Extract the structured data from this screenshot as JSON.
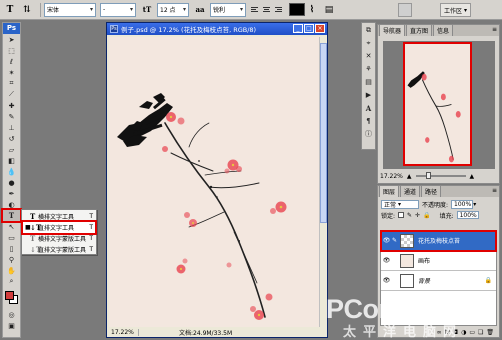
{
  "options_bar": {
    "tool_icon": "type-tool-icon",
    "orientation_icon": "text-orientation-icon",
    "font_family": "宋体",
    "font_style": "-",
    "size_icon": "font-size-icon",
    "font_size": "12 点",
    "aa_icon": "anti-alias-icon",
    "anti_alias": "锐利",
    "text_color": "#000000",
    "workspace_label": "工作区"
  },
  "toolbox": {
    "logo": "Ps",
    "foreground_color": "#d23c3c",
    "background_color": "#ffffff"
  },
  "flyout": {
    "items": [
      {
        "label": "横排文字工具",
        "shortcut": "T",
        "selected": false
      },
      {
        "label": "直排文字工具",
        "shortcut": "T",
        "selected": true
      },
      {
        "label": "横排文字蒙版工具",
        "shortcut": "T",
        "selected": false
      },
      {
        "label": "直排文字蒙版工具",
        "shortcut": "T",
        "selected": false
      }
    ]
  },
  "document": {
    "title": "例子.psd @ 17.2% (花托及梅枝点苔, RGB/8)",
    "zoom": "17.22%",
    "doc_info": "文档:24.9M/33.5M"
  },
  "navigator_panel": {
    "tabs": [
      "导航器",
      "直方图",
      "信息"
    ],
    "zoom": "17.22%"
  },
  "layers_panel": {
    "tabs": [
      "图层",
      "通道",
      "路径"
    ],
    "blend_mode": "正常",
    "opacity_label": "不透明度:",
    "opacity": "100%",
    "lock_label": "锁定:",
    "fill_label": "填充:",
    "fill": "100%",
    "layers": [
      {
        "name": "花托及梅枝点苔",
        "selected": true,
        "thumb": "checker"
      },
      {
        "name": "画布",
        "selected": false,
        "thumb": "pink"
      },
      {
        "name": "背景",
        "selected": false,
        "thumb": "white",
        "locked": true
      }
    ]
  },
  "watermark": {
    "main": "PConline",
    "suffix": ".com.cn",
    "sub": "太平洋电脑网"
  },
  "colors": {
    "accent_red": "#e00000",
    "selection_blue": "#316ac5",
    "canvas": "#f3e7df",
    "blossom": "#e8434f"
  }
}
